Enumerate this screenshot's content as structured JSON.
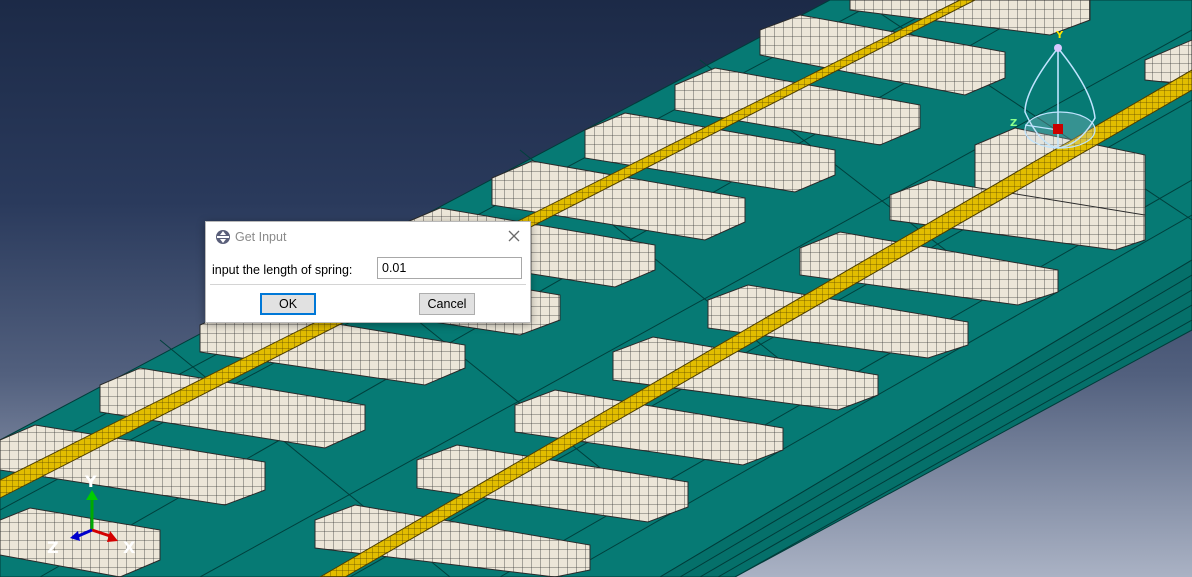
{
  "dialog": {
    "title": "Get Input",
    "prompt": "input the length of spring:",
    "value": "0.01",
    "ok_label": "OK",
    "cancel_label": "Cancel",
    "icon": "abaqus-logo-icon",
    "close_icon": "close-icon"
  },
  "triad": {
    "x_label": "X",
    "y_label": "Y",
    "z_label": "Z"
  },
  "view_cube": {
    "y_label": "Y",
    "z_label": "Z"
  },
  "colors": {
    "slab": "#067a74",
    "rail": "#d9b400",
    "sleeper": "#ece6d8",
    "triad_x": "#d40000",
    "triad_y": "#00aa00",
    "triad_z": "#0000cc"
  }
}
